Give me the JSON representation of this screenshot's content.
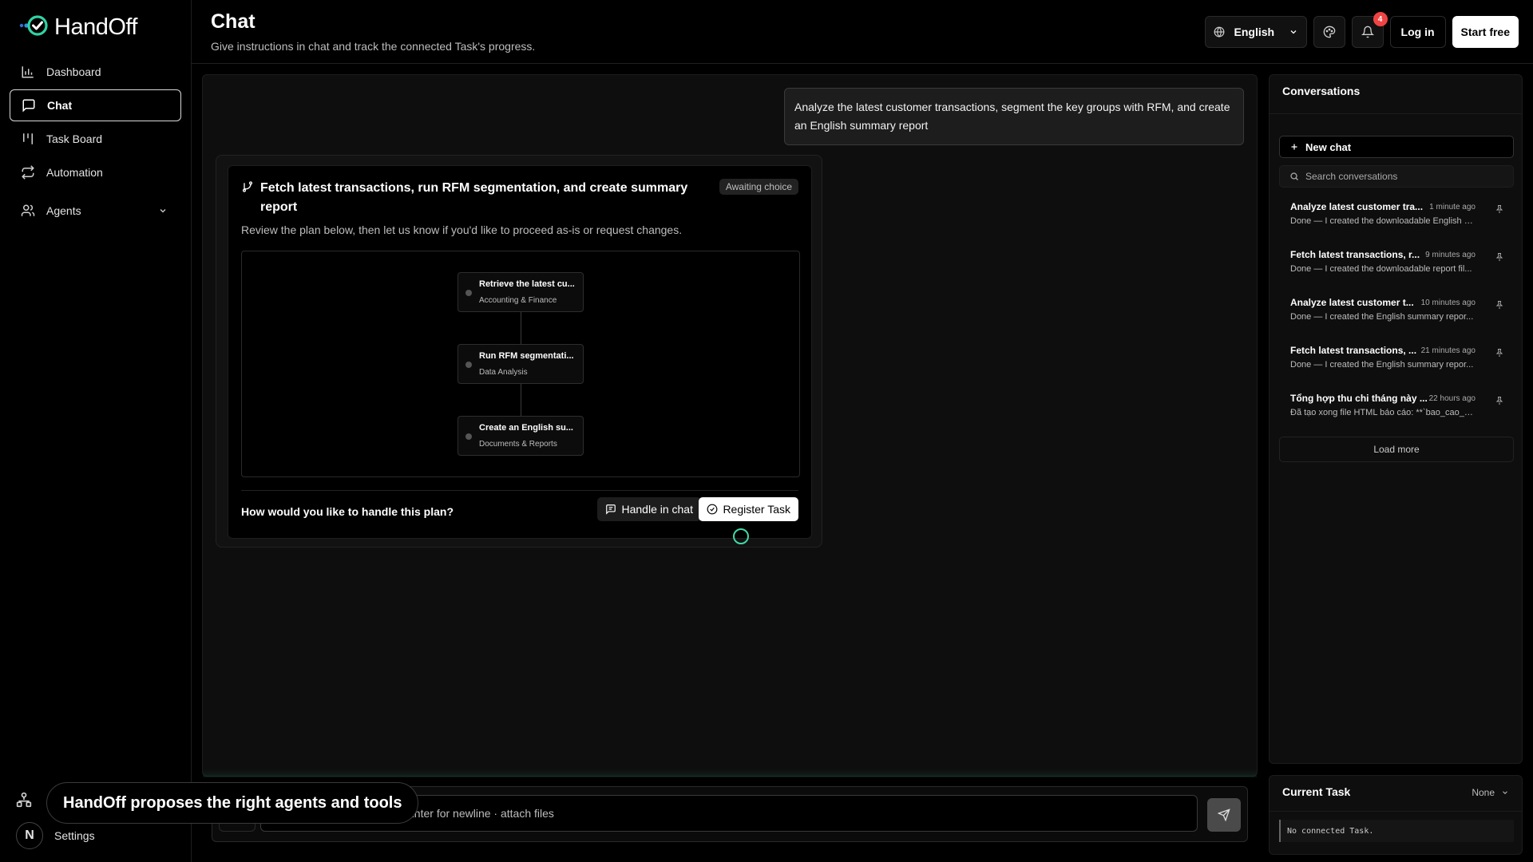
{
  "brand": {
    "name": "HandOff",
    "accent": "#2fd3a4"
  },
  "sidebar": {
    "items": [
      {
        "label": "Dashboard",
        "icon": "bar-chart-icon"
      },
      {
        "label": "Chat",
        "icon": "message-square-icon",
        "active": true
      },
      {
        "label": "Task Board",
        "icon": "kanban-icon"
      },
      {
        "label": "Automation",
        "icon": "repeat-icon"
      },
      {
        "label": "Agents",
        "icon": "users-icon",
        "expandable": true
      }
    ],
    "settings_label": "Settings",
    "avatar_initial": "N"
  },
  "header": {
    "title": "Chat",
    "subtitle": "Give instructions in chat and track the connected Task's progress.",
    "language": "English",
    "notification_count": "4",
    "login_label": "Log in",
    "start_label": "Start free"
  },
  "chat": {
    "user_message": "Analyze the latest customer transactions, segment the key groups with RFM, and create an English summary report",
    "plan": {
      "title": "Fetch latest transactions, run RFM segmentation, and create summary report",
      "status": "Awaiting choice",
      "description": "Review the plan below, then let us know if you'd like to proceed as-is or request changes.",
      "steps": [
        {
          "title": "Retrieve the latest cu...",
          "agent": "Accounting & Finance"
        },
        {
          "title": "Run RFM segmentati...",
          "agent": "Data Analysis"
        },
        {
          "title": "Create an English su...",
          "agent": "Documents & Reports"
        }
      ],
      "question": "How would you like to handle this plan?",
      "handle_label": "Handle in chat",
      "register_label": "Register Task"
    },
    "composer_placeholder": "ntion · Enter to send · Ctrl+Enter for newline · attach files",
    "toast": "HandOff proposes the right agents and tools"
  },
  "conversations": {
    "title": "Conversations",
    "new_chat_label": "New chat",
    "search_placeholder": "Search conversations",
    "items": [
      {
        "title": "Analyze latest customer tra...",
        "time": "1 minute ago",
        "snippet": "Done — I created the downloadable English s..."
      },
      {
        "title": "Fetch latest transactions, r...",
        "time": "9 minutes ago",
        "snippet": "Done — I created the downloadable report fil..."
      },
      {
        "title": "Analyze latest customer t...",
        "time": "10 minutes ago",
        "snippet": "Done — I created the English summary repor..."
      },
      {
        "title": "Fetch latest transactions, ...",
        "time": "21 minutes ago",
        "snippet": "Done — I created the English summary repor..."
      },
      {
        "title": "Tổng hợp thu chi tháng này ...",
        "time": "22 hours ago",
        "snippet": "Đã tạo xong file HTML báo cáo: **`bao_cao_t..."
      }
    ],
    "load_more_label": "Load more"
  },
  "current_task": {
    "title": "Current Task",
    "selected": "None",
    "status_text": "No connected Task."
  }
}
